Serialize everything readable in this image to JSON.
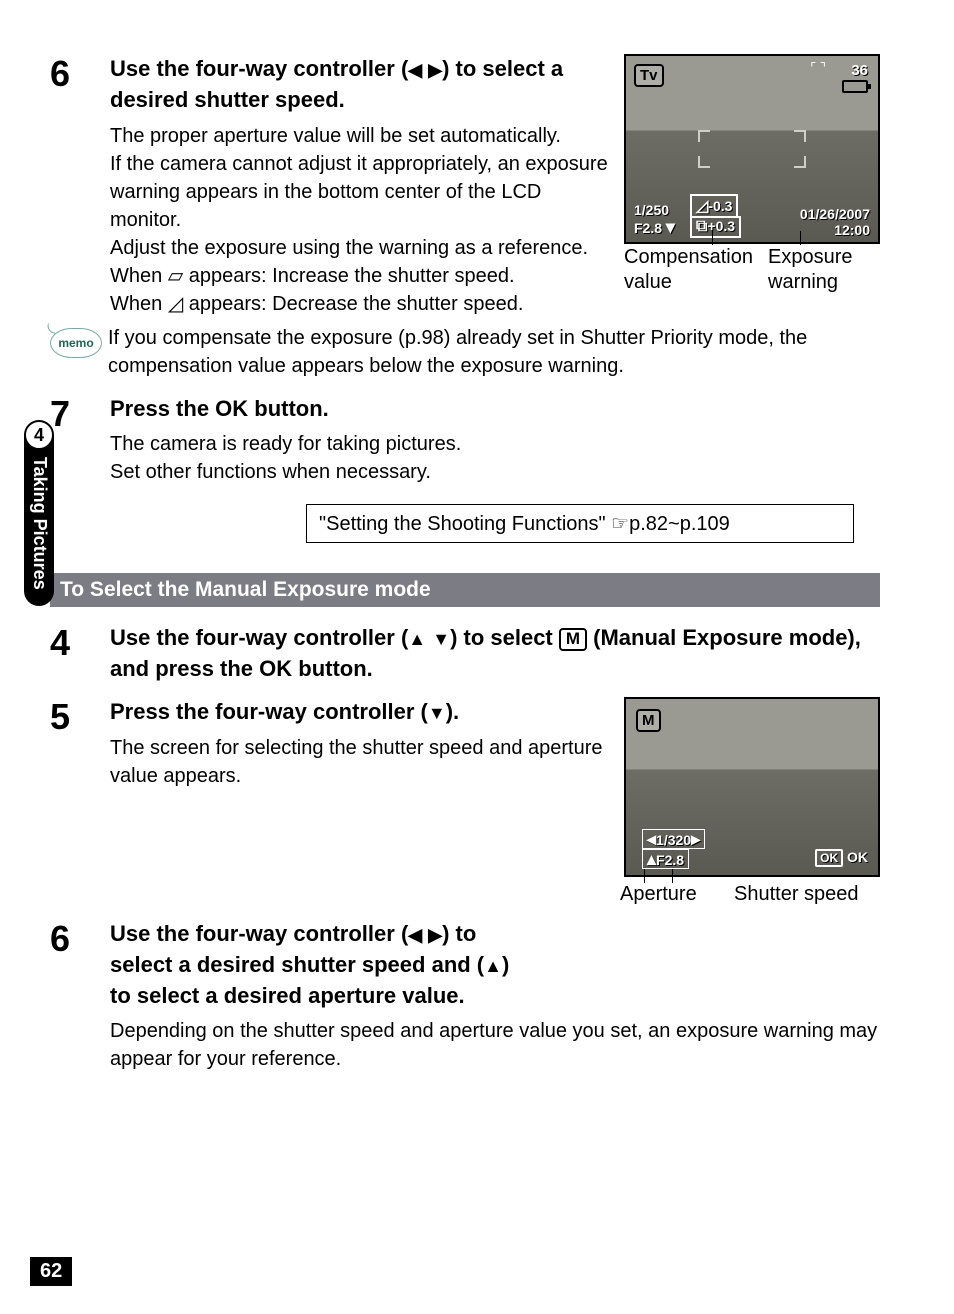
{
  "sidebar": {
    "chapter_num": "4",
    "chapter_title": "Taking Pictures"
  },
  "step6a": {
    "num": "6",
    "title_a": "Use the four-way controller (",
    "title_b": ") to select a desired shutter speed.",
    "p1": "The proper aperture value will be set automatically.",
    "p2": "If the camera cannot adjust it appropriately, an exposure warning appears in the bottom center of the LCD monitor.",
    "p3": "Adjust the exposure using the warning as a reference.",
    "p4a": "When ",
    "p4b": " appears: Increase the shutter speed.",
    "p5a": "When ",
    "p5b": " appears: Decrease the shutter speed."
  },
  "lcd1": {
    "mode": "Tv",
    "shots": "36",
    "shutter": "1/250",
    "aperture": "F2.8",
    "expwarn": "-0.3",
    "expcomp": "+0.3",
    "date": "01/26/2007",
    "time": "12:00"
  },
  "fig1_caption": {
    "left": "Compensation value",
    "right": "Exposure warning"
  },
  "memo": {
    "label": "memo",
    "text": "If you compensate the exposure (p.98) already set in Shutter Priority mode, the compensation value appears below the exposure warning."
  },
  "step7": {
    "num": "7",
    "title": "Press the OK button.",
    "p1": "The camera is ready for taking pictures.",
    "p2": "Set other functions when necessary."
  },
  "linkbox": {
    "text": "\"Setting the Shooting Functions\" ",
    "ref": "p.82~p.109"
  },
  "section_bar": "To Select the Manual Exposure mode",
  "step4": {
    "num": "4",
    "title_a": "Use the four-way controller (",
    "title_b": ") to select ",
    "mode_letter": "M",
    "title_c": " (Manual Exposure mode), and press the OK button."
  },
  "step5": {
    "num": "5",
    "title_a": "Press the four-way controller (",
    "title_b": ").",
    "p1": "The screen for selecting the shutter speed and aperture value appears."
  },
  "step6b": {
    "num": "6",
    "title_a": "Use the four-way controller (",
    "title_b": ") to select a desired shutter speed and (",
    "title_c": ") to select a desired aperture value.",
    "p1": "Depending on the shutter speed and aperture value you set, an exposure warning may appear for your reference."
  },
  "lcd2": {
    "mode": "M",
    "shutter": "1/320",
    "aperture": "F2.8",
    "ok_box": "OK",
    "ok_text": "OK"
  },
  "fig2_caption": {
    "left": "Aperture",
    "right": "Shutter speed"
  },
  "page_number": "62"
}
